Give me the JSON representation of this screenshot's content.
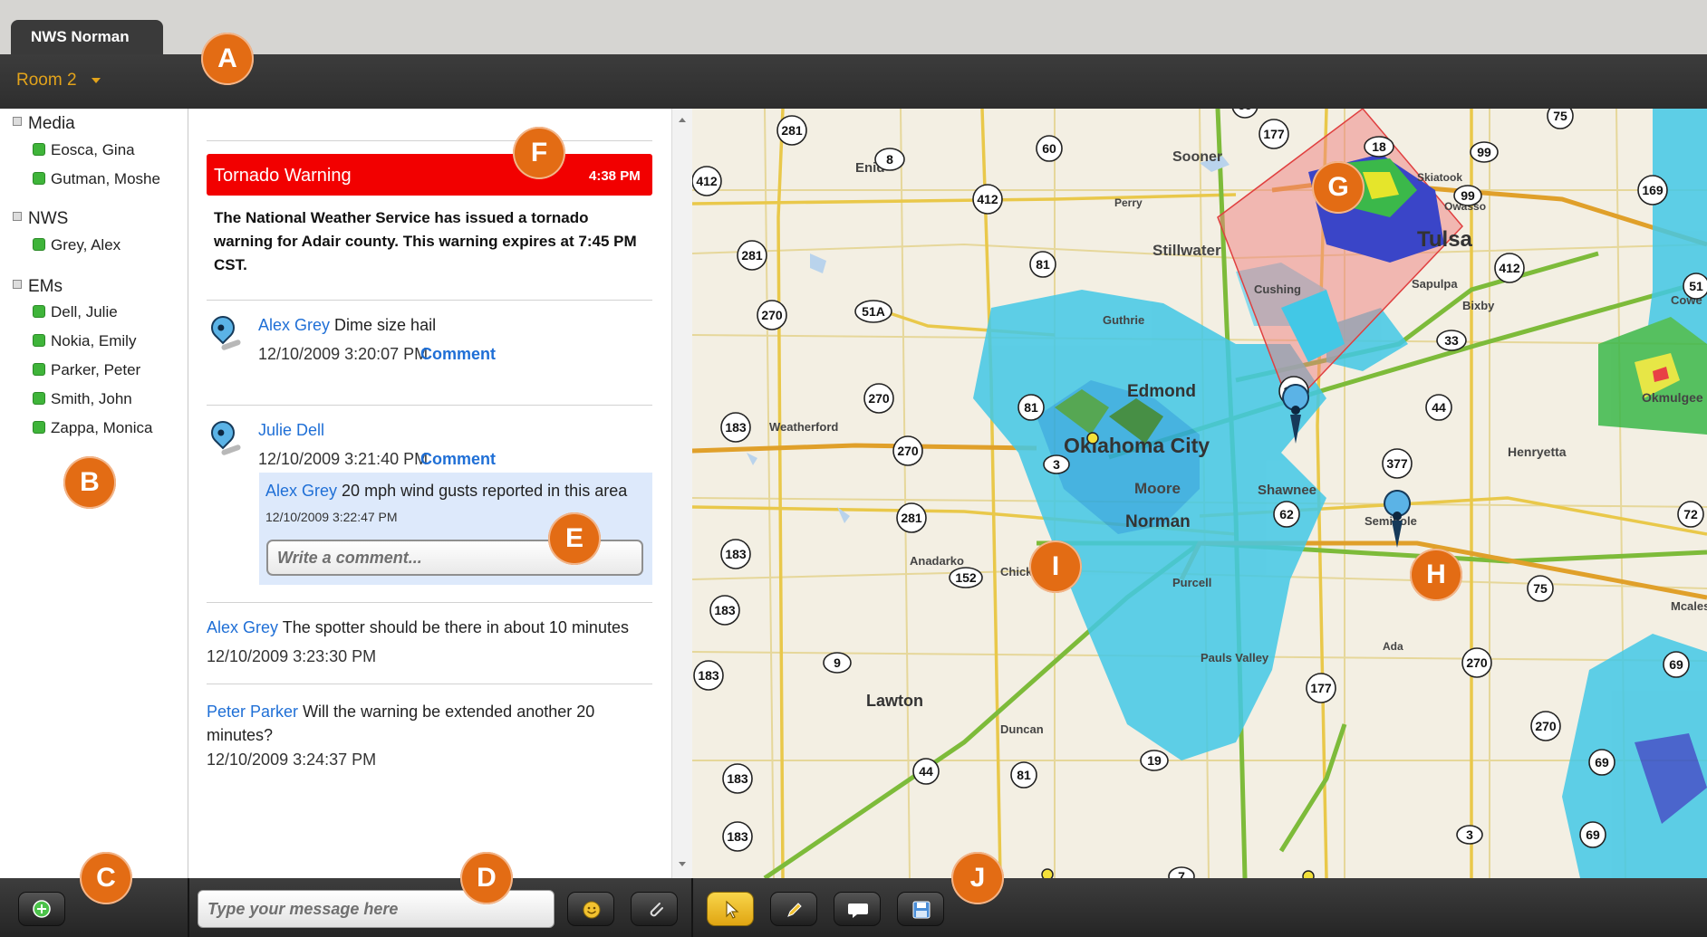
{
  "app": {
    "tab": "NWS Norman",
    "room": "Room 2"
  },
  "roster": {
    "groups": [
      {
        "name": "Media",
        "members": [
          "Eosca, Gina",
          "Gutman, Moshe"
        ]
      },
      {
        "name": "NWS",
        "members": [
          "Grey, Alex"
        ]
      },
      {
        "name": "EMs",
        "members": [
          "Dell, Julie",
          "Nokia, Emily",
          "Parker, Peter",
          "Smith, John",
          "Zappa, Monica"
        ]
      }
    ]
  },
  "chat": {
    "warning": {
      "title": "Tornado Warning",
      "time": "4:38 PM",
      "body": "The National Weather Service has issued a tornado warning for Adair county. This warning expires at 7:45 PM CST."
    },
    "messages": [
      {
        "user": "Alex Grey",
        "text": "Dime size hail",
        "time": "12/10/2009 3:20:07 PM",
        "link": "Comment"
      },
      {
        "user": "Julie Dell",
        "text": "",
        "time": "12/10/2009 3:21:40 PM",
        "link": "Comment",
        "reply": {
          "user": "Alex Grey",
          "text": "20 mph wind gusts reported in this area",
          "time": "12/10/2009 3:22:47 PM"
        },
        "comment_placeholder": "Write a comment..."
      },
      {
        "user": "Alex Grey",
        "text": "The spotter should be there in about 10 minutes",
        "time": "12/10/2009 3:23:30 PM"
      },
      {
        "user": "Peter Parker",
        "text": "Will the warning be extended another 20 minutes?",
        "time": "12/10/2009 3:24:37 PM"
      }
    ]
  },
  "composer": {
    "placeholder": "Type your message here"
  },
  "map": {
    "cities": [
      "Enid",
      "Perry",
      "Stillwater",
      "Tulsa",
      "Owasso",
      "Skiatook",
      "Sooner",
      "Cushing",
      "Sapulpa",
      "Bixby",
      "Cowe",
      "Guthrie",
      "Edmond",
      "Oklahoma City",
      "Moore",
      "Norman",
      "Shawnee",
      "Seminole",
      "Henryetta",
      "Okmulgee",
      "Weatherford",
      "Anadarko",
      "Chickasha",
      "Purcell",
      "Pauls Valley",
      "Ada",
      "Mcalester",
      "Lawton",
      "Duncan"
    ],
    "shields": [
      "281",
      "8",
      "60",
      "177",
      "18",
      "99",
      "75",
      "412",
      "99",
      "169",
      "412",
      "81",
      "281",
      "270",
      "51A",
      "412",
      "33",
      "44",
      "270",
      "81",
      "177",
      "183",
      "270",
      "3",
      "377",
      "62",
      "281",
      "152",
      "183",
      "183",
      "72",
      "75",
      "9",
      "183",
      "270",
      "177",
      "69",
      "270",
      "19",
      "69",
      "44",
      "81",
      "183",
      "183",
      "3",
      "7",
      "69",
      "412",
      "51"
    ],
    "warning_polygon_color": "#f08080"
  },
  "callouts": [
    "A",
    "B",
    "C",
    "D",
    "E",
    "F",
    "G",
    "H",
    "I",
    "J"
  ],
  "icons": [
    "add-contact-icon",
    "smiley-icon",
    "attach-icon",
    "pointer-icon",
    "pencil-icon",
    "speech-bubble-icon",
    "save-disk-icon",
    "map-pin-icon"
  ]
}
